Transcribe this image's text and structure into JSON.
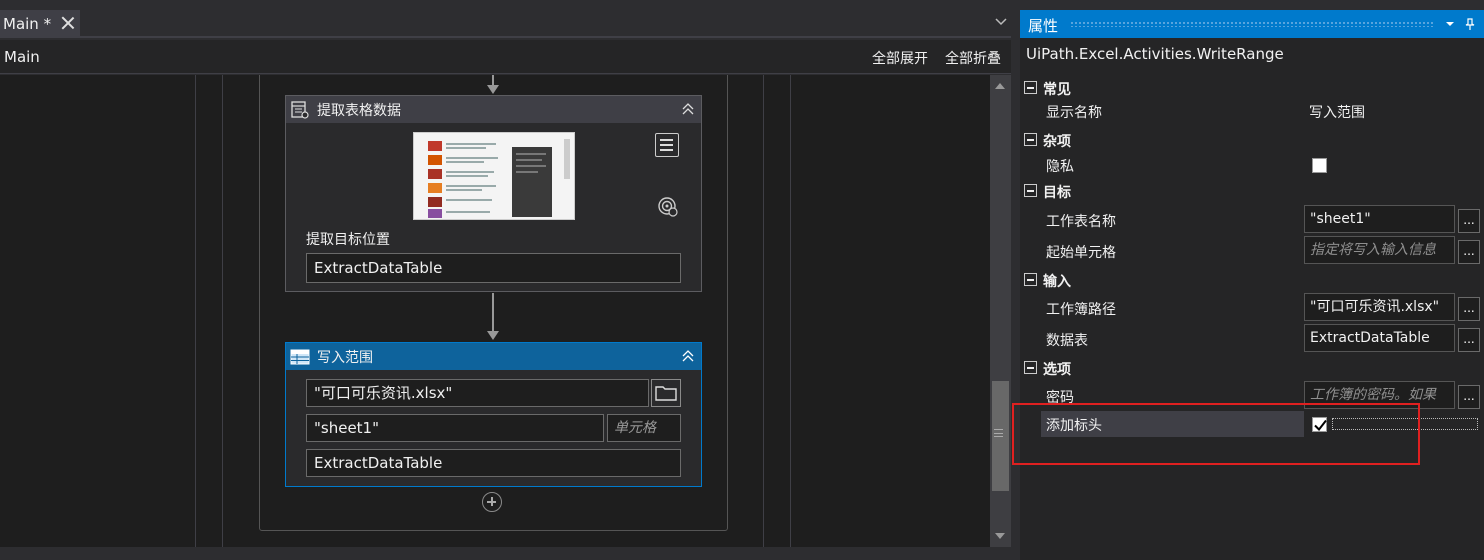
{
  "tab": {
    "label": "Main *"
  },
  "breadcrumb": {
    "label": "Main",
    "expand_all": "全部展开",
    "collapse_all": "全部折叠"
  },
  "extract_activity": {
    "title": "提取表格数据",
    "field_label": "提取目标位置",
    "output_value": "ExtractDataTable"
  },
  "write_activity": {
    "title": "写入范围",
    "workbook_path": "\"可口可乐资讯.xlsx\"",
    "sheet_name": "\"sheet1\"",
    "cell_placeholder": "单元格",
    "data_table": "ExtractDataTable"
  },
  "properties": {
    "title": "属性",
    "type_name": "UiPath.Excel.Activities.WriteRange",
    "categories": {
      "common": "常见",
      "misc": "杂项",
      "target": "目标",
      "input": "输入",
      "options": "选项"
    },
    "display_name": {
      "label": "显示名称",
      "value": "写入范围"
    },
    "privacy": {
      "label": "隐私",
      "checked": false
    },
    "sheet_name": {
      "label": "工作表名称",
      "value": "\"sheet1\""
    },
    "starting_cell": {
      "label": "起始单元格",
      "placeholder": "指定将写入输入信息"
    },
    "workbook_path": {
      "label": "工作簿路径",
      "value": "\"可口可乐资讯.xlsx\""
    },
    "data_table": {
      "label": "数据表",
      "value": "ExtractDataTable"
    },
    "password": {
      "label": "密码",
      "placeholder": "工作簿的密码。如果"
    },
    "add_headers": {
      "label": "添加标头",
      "checked": true
    },
    "ellipsis": "..."
  },
  "colors": {
    "accent": "#007acc",
    "selected_header": "#0e639c",
    "highlight_box": "#e02020"
  }
}
